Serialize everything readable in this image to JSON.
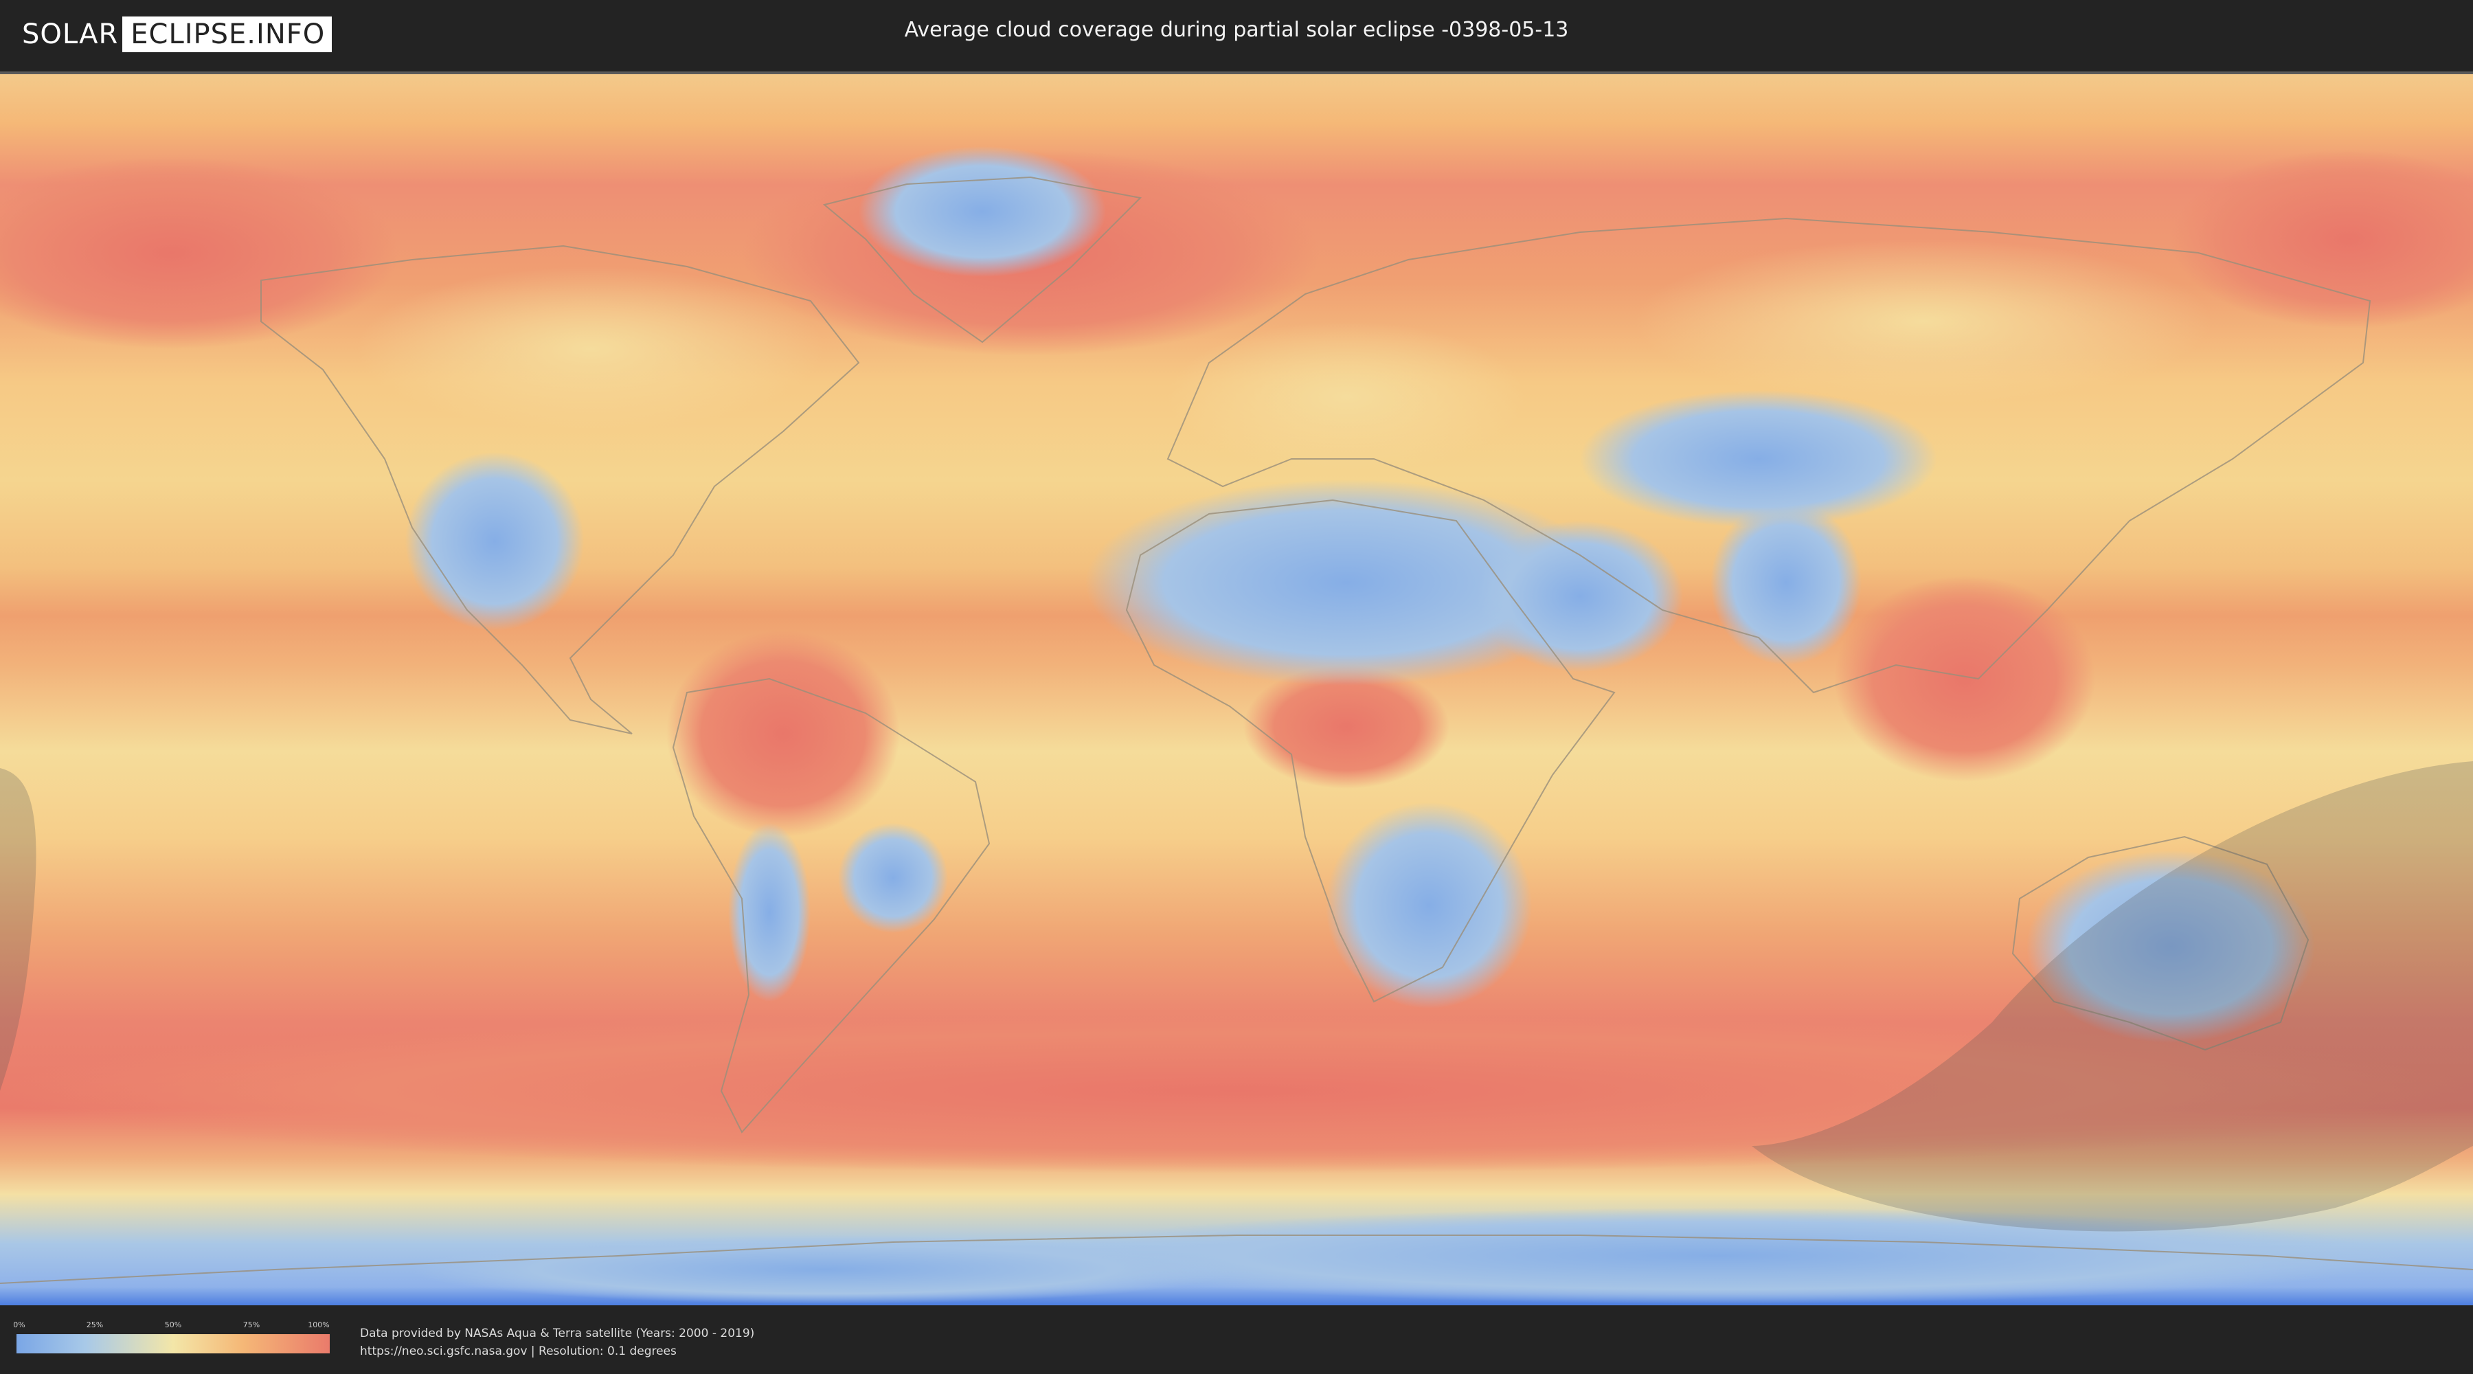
{
  "header": {
    "logo_left": "SOLAR",
    "logo_right": "ECLIPSE.INFO",
    "title": "Average cloud coverage during partial solar eclipse -0398-05-13"
  },
  "map": {
    "layer": "cloud coverage",
    "colors": {
      "clear": "#7aa6e6",
      "low": "#a8c9e8",
      "mid": "#f3e6a8",
      "high": "#f5b877",
      "overcast": "#ea7b6b",
      "eclipse_shadow": "#6b6b6b"
    }
  },
  "legend": {
    "ticks": [
      "0%",
      "25%",
      "50%",
      "75%",
      "100%"
    ]
  },
  "credits": {
    "line1": "Data provided by NASAs Aqua & Terra satellite (Years: 2000 - 2019)",
    "line2": "https://neo.sci.gsfc.nasa.gov | Resolution: 0.1 degrees"
  }
}
